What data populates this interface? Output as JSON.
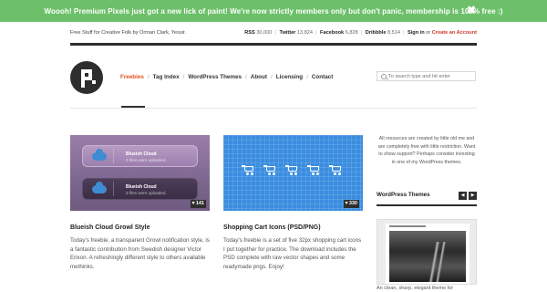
{
  "notice": {
    "message": "Woooh! Premium Pixels just got a new lick of paint! We're now strictly members only but don't panic, membership is 100% free :)",
    "close_glyph": "✖",
    "color": "#6cc069"
  },
  "topbar": {
    "tagline": "Free Stuff for Creative Folk by Orman Clark, Yessir.",
    "stats": [
      {
        "label": "RSS",
        "value": "30,000"
      },
      {
        "label": "Twitter",
        "value": "13,824"
      },
      {
        "label": "Facebook",
        "value": "6,828"
      },
      {
        "label": "Dribbble",
        "value": "8,514"
      }
    ],
    "sign_in": "Sign in",
    "or": "or",
    "create_account": "Create an Account"
  },
  "nav": {
    "items": [
      "Freebies",
      "Tag Index",
      "WordPress Themes",
      "About",
      "Licensing",
      "Contact"
    ],
    "separator": "/",
    "active_color": "#e0501d"
  },
  "search": {
    "placeholder": "To search type and hit enter",
    "value": ""
  },
  "cards": [
    {
      "title": "Blueish Cloud Growl Style",
      "description": "Today's freebie, a transparent Growl notification style, is a fantastic contribution from Swedish designer Victor Erixon. A refreshingly different style to others available methinks.",
      "likes": "141",
      "growl_title": "Blueish Cloud",
      "growl_subtitle": "3 files were uploaded."
    },
    {
      "title": "Shopping Cart Icons (PSD/PNG)",
      "description": "Today's freebie is a set of five 32px shopping cart icons I put together for practice. The download includes the PSD complete with raw vector shapes and some readymade pngs. Enjoy!",
      "likes": "330"
    }
  ],
  "sidebar": {
    "intro": "All resources are created by little old me and are completely free with little restriction. Want to show support? Perhaps consider investing in one of my WordPress themes.",
    "widget_title": "WordPress Themes",
    "prev_glyph": "◀",
    "next_glyph": "▶",
    "theme_caption": "An clean, sharp, elegant theme for"
  }
}
